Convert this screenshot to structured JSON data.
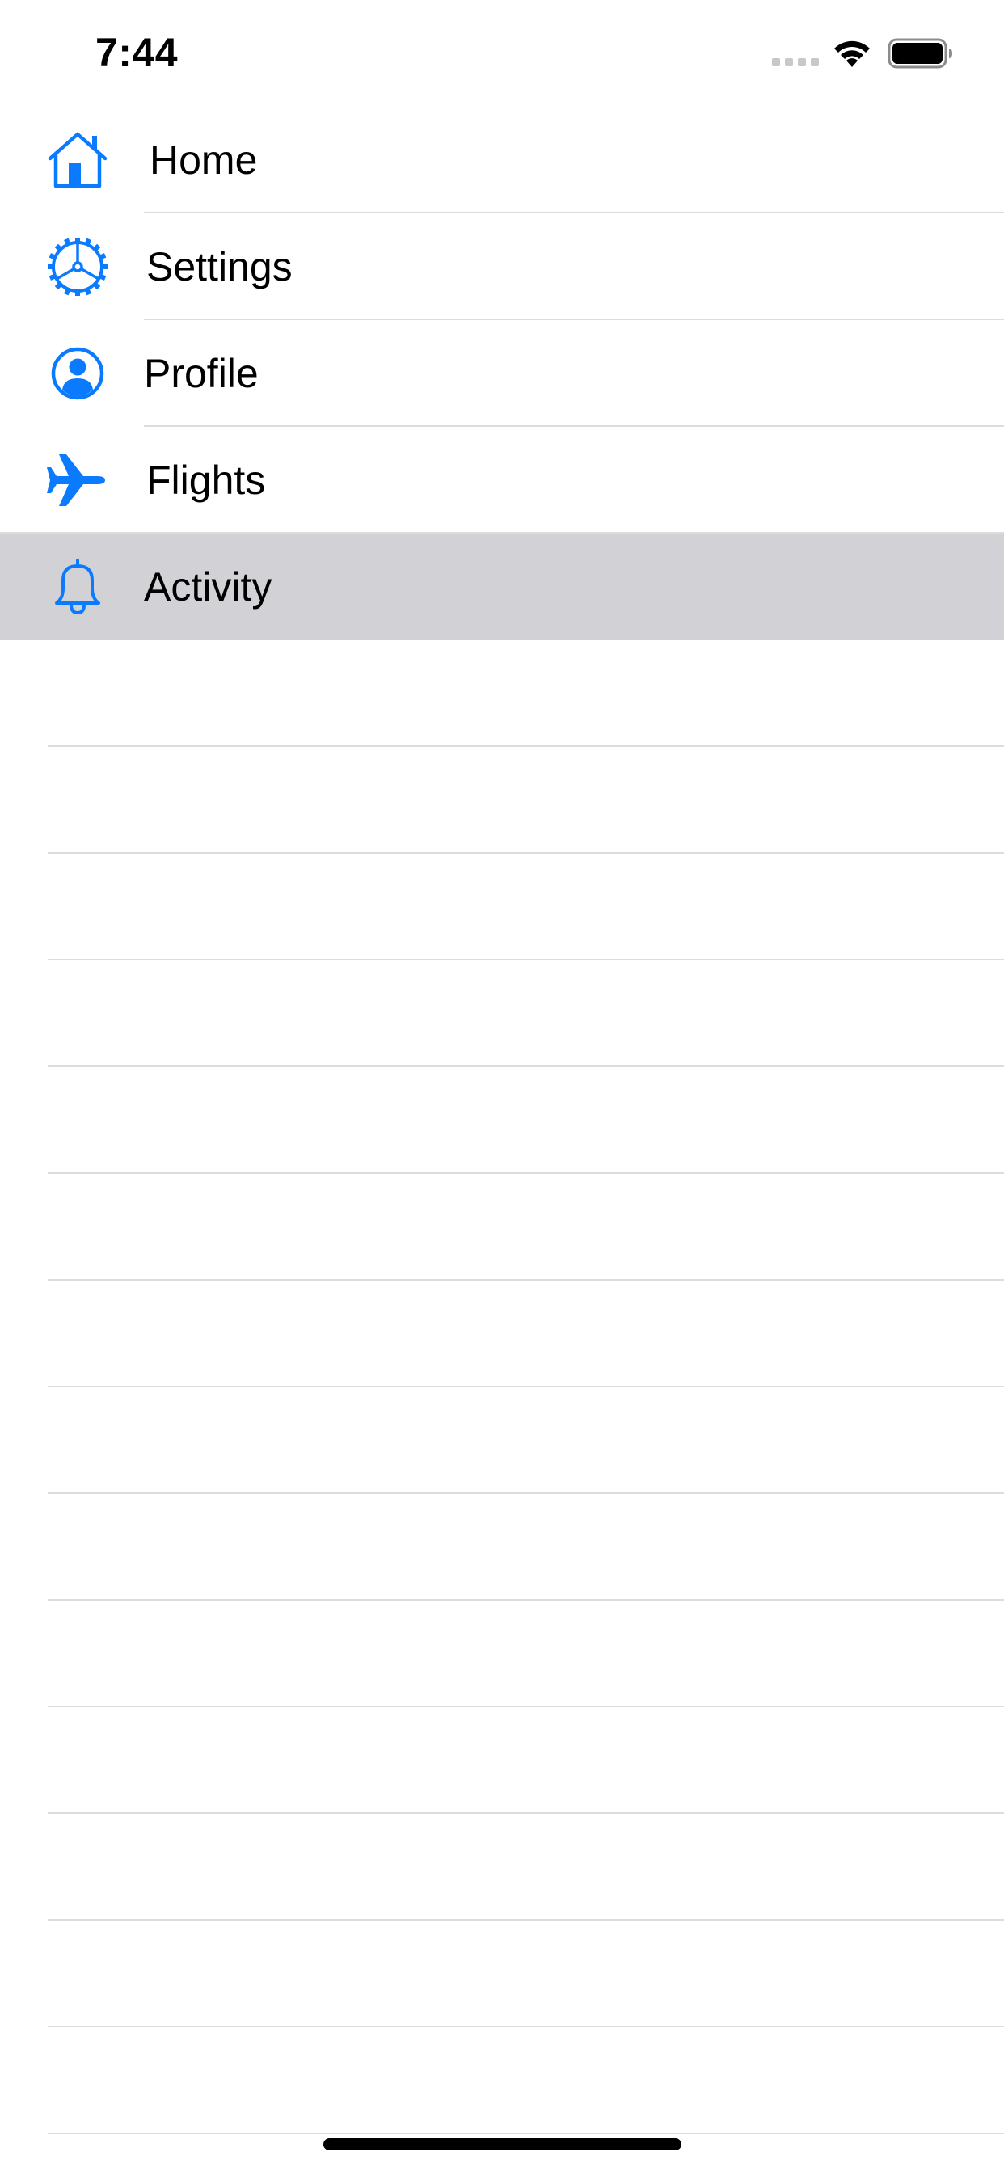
{
  "status_bar": {
    "time": "7:44"
  },
  "menu": {
    "items": [
      {
        "label": "Home",
        "icon": "house-icon",
        "selected": false
      },
      {
        "label": "Settings",
        "icon": "gear-icon",
        "selected": false
      },
      {
        "label": "Profile",
        "icon": "person-circle-icon",
        "selected": false
      },
      {
        "label": "Flights",
        "icon": "airplane-icon",
        "selected": false
      },
      {
        "label": "Activity",
        "icon": "bell-icon",
        "selected": true
      }
    ]
  },
  "colors": {
    "accent": "#0a7aff",
    "selected_row": "#d1d1d6",
    "separator": "#dcdcdf"
  }
}
